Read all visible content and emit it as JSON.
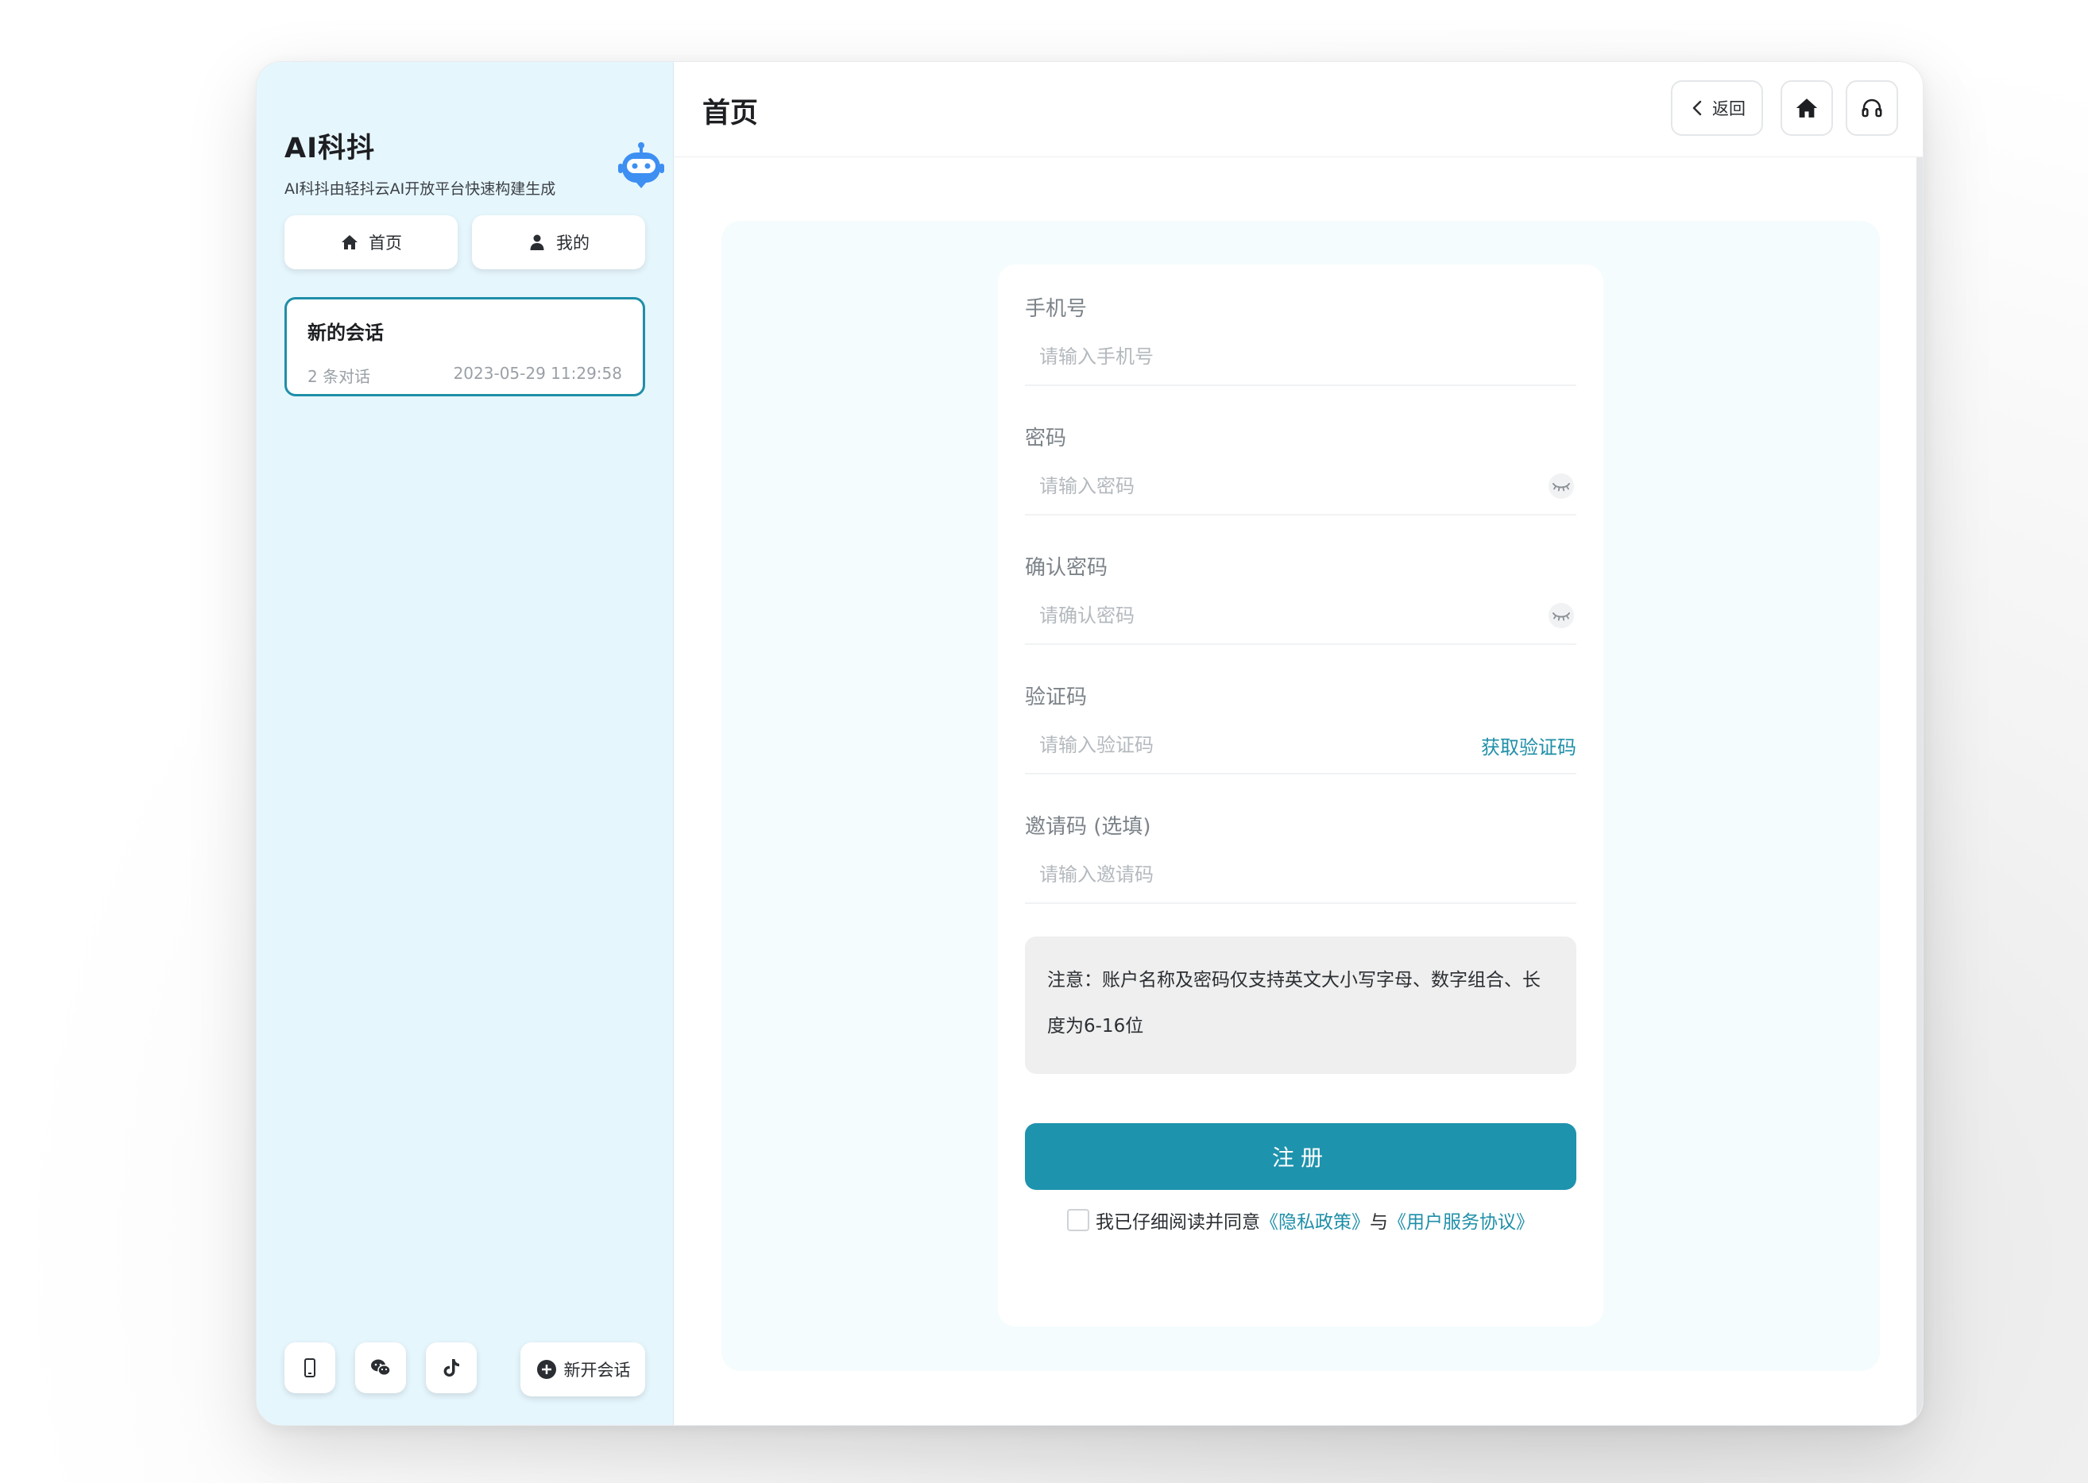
{
  "sidebar": {
    "brand_title": "AI科抖",
    "brand_subtitle": "AI科抖由轻抖云AI开放平台快速构建生成",
    "nav": [
      {
        "label": "首页",
        "icon": "home-icon"
      },
      {
        "label": "我的",
        "icon": "user-icon"
      }
    ],
    "sessions": [
      {
        "title": "新的会话",
        "count": "2 条对话",
        "time": "2023-05-29 11:29:58"
      }
    ],
    "bottom": {
      "icons": [
        "phone-icon",
        "wechat-icon",
        "tiktok-icon"
      ],
      "new_chat_label": "新开会话"
    }
  },
  "header": {
    "title": "首页",
    "back_label": "返回",
    "home_icon": "home-icon",
    "support_icon": "headset-icon"
  },
  "form": {
    "phone": {
      "label": "手机号",
      "placeholder": "请输入手机号",
      "value": ""
    },
    "password": {
      "label": "密码",
      "placeholder": "请输入密码",
      "value": ""
    },
    "confirm": {
      "label": "确认密码",
      "placeholder": "请确认密码",
      "value": ""
    },
    "code": {
      "label": "验证码",
      "placeholder": "请输入验证码",
      "value": "",
      "action": "获取验证码"
    },
    "invite": {
      "label": "邀请码 (选填)",
      "placeholder": "请输入邀请码",
      "value": ""
    },
    "notice": "注意：账户名称及密码仅支持英文大小写字母、数字组合、长度为6-16位",
    "submit_label": "注册",
    "agree": {
      "checked": false,
      "prefix": "我已仔细阅读并同意",
      "privacy": "《隐私政策》",
      "joiner": "与",
      "terms": "《用户服务协议》"
    }
  },
  "colors": {
    "accent": "#1e93ad",
    "sidebar_bg": "#e6f6fd",
    "panel_bg": "#f4fcfe",
    "robot": "#3d8ff2"
  }
}
